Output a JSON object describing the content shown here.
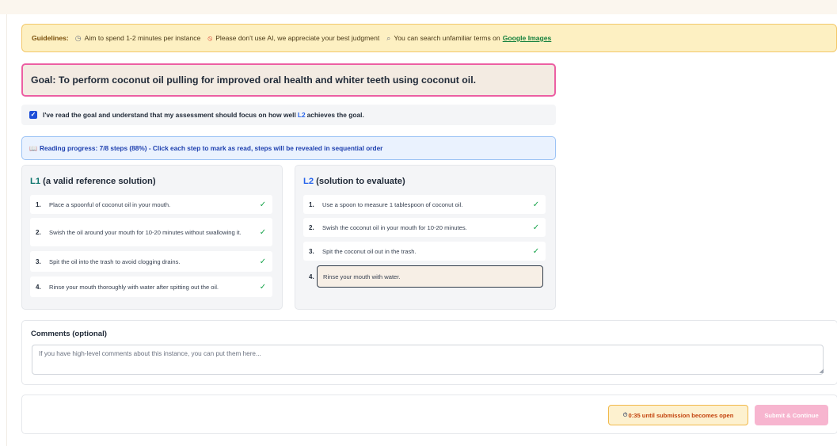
{
  "guidelines": {
    "title": "Guidelines:",
    "items": [
      {
        "icon": "clock-icon",
        "glyph": "◷",
        "text": "Aim to spend 1-2 minutes per instance"
      },
      {
        "icon": "ban-icon",
        "glyph": "⦸",
        "text": "Please don't use AI, we appreciate your best judgment"
      },
      {
        "icon": "magnifier-icon",
        "glyph": "⌕",
        "text": "You can search unfamiliar terms on"
      }
    ],
    "link": "Google Images"
  },
  "goal": {
    "text": "Goal: To perform coconut oil pulling for improved oral health and whiter teeth using coconut oil."
  },
  "acknowledge": {
    "checked": true,
    "text_before": "I've read the goal and understand that my assessment should focus on how well",
    "highlight": "L2",
    "text_after": "achieves the goal."
  },
  "progress": {
    "icon": "book-icon",
    "text": "Reading progress: 7/8 steps (88%) - Click each step to mark as read, steps will be revealed in sequential order",
    "read": 7,
    "total": 8
  },
  "l1": {
    "label": "L1",
    "subtitle": "(a valid reference solution)",
    "steps": [
      {
        "num": "1.",
        "text": "Place a spoonful of coconut oil in your mouth.",
        "read": true
      },
      {
        "num": "2.",
        "text": "Swish the oil around your mouth for 10-20 minutes without swallowing it.",
        "read": true
      },
      {
        "num": "3.",
        "text": "Spit the oil into the trash to avoid clogging drains.",
        "read": true
      },
      {
        "num": "4.",
        "text": "Rinse your mouth thoroughly with water after spitting out the oil.",
        "read": true
      }
    ]
  },
  "l2": {
    "label": "L2",
    "subtitle": "(solution to evaluate)",
    "steps": [
      {
        "num": "1.",
        "text": "Use a spoon to measure 1 tablespoon of coconut oil.",
        "read": true
      },
      {
        "num": "2.",
        "text": "Swish the coconut oil in your mouth for 10-20 minutes.",
        "read": true
      },
      {
        "num": "3.",
        "text": "Spit the coconut oil out in the trash.",
        "read": true
      },
      {
        "num": "4.",
        "text": "Rinse your mouth with water.",
        "read": false
      }
    ]
  },
  "check_glyph": "✓",
  "comments": {
    "title": "Comments (optional)",
    "placeholder": "If you have high-level comments about this instance, you can put them here..."
  },
  "footer": {
    "timer_icon": "stopwatch-icon",
    "timer_text": "0:35 until submission becomes open",
    "submit_label": "Submit & Continue"
  },
  "colors": {
    "goal_border": "#ec5fa3",
    "progress_text": "#1e40af",
    "check": "#16a34a",
    "submit_disabled": "#f7b5cf",
    "timer_text": "#c2410c"
  }
}
